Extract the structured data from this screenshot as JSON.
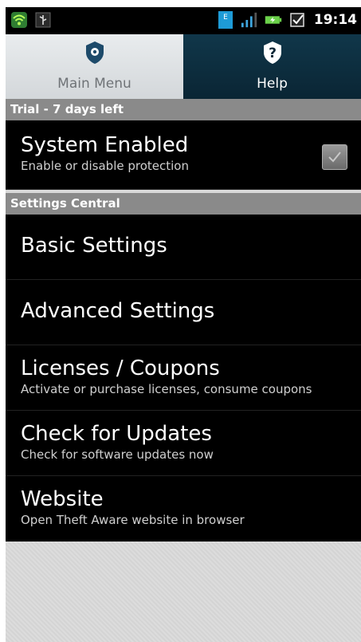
{
  "statusbar": {
    "time": "19:14",
    "left_icons": [
      "wifi-app-icon",
      "usb-icon"
    ],
    "right_icons": [
      "edge-data-icon",
      "signal-icon",
      "battery-charging-icon",
      "checkbox-notification-icon"
    ]
  },
  "tabs": [
    {
      "label": "Main Menu",
      "icon": "shield-gear-icon",
      "selected": true
    },
    {
      "label": "Help",
      "icon": "question-icon",
      "selected": false
    }
  ],
  "trial": {
    "label": "Trial - 7 days left"
  },
  "system": {
    "title": "System Enabled",
    "subtitle": "Enable or disable protection",
    "checked": true
  },
  "settings_central": {
    "label": "Settings Central"
  },
  "menu": [
    {
      "title": "Basic Settings",
      "subtitle": ""
    },
    {
      "title": "Advanced Settings",
      "subtitle": ""
    },
    {
      "title": "Licenses / Coupons",
      "subtitle": "Activate or purchase licenses, consume coupons"
    },
    {
      "title": "Check for Updates",
      "subtitle": "Check for software updates now"
    },
    {
      "title": "Website",
      "subtitle": "Open Theft Aware website in browser"
    }
  ],
  "colors": {
    "help_tab_bg": "#0a2534",
    "main_tab_bg": "#d3d7da",
    "section_header_bg": "#8a8a8a",
    "row_bg": "#000000"
  }
}
